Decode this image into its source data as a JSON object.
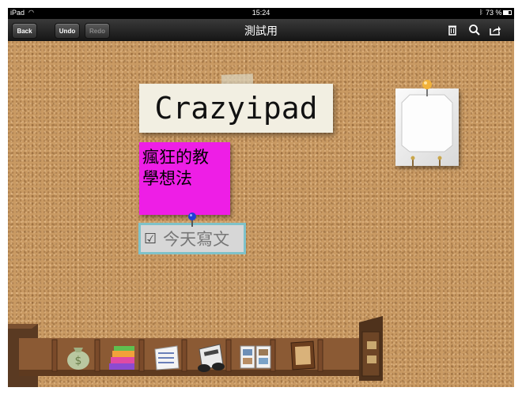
{
  "status_bar": {
    "device": "iPad",
    "time": "15:24",
    "battery": "73 %"
  },
  "navbar": {
    "back_label": "Back",
    "undo_label": "Undo",
    "redo_label": "Redo",
    "title": "測試用",
    "icons": [
      "trash-icon",
      "search-icon",
      "share-icon"
    ]
  },
  "board": {
    "title_note": "Crazyipad",
    "pink_note": [
      "瘋狂的教",
      "學想法"
    ],
    "todo_note": {
      "checkbox": "☑",
      "text": "今天寫文"
    }
  },
  "shelf": {
    "items": [
      "money-bag-icon",
      "books-icon",
      "calendar-icon",
      "newspaper-icon",
      "photo-album-icon",
      "frame-icon"
    ]
  },
  "colors": {
    "cork": "#c99a63",
    "pink_note": "#ee1ee6",
    "todo_border": "#7fc2c9"
  }
}
